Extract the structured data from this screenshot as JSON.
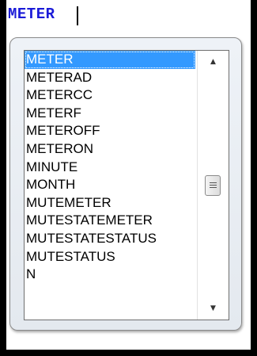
{
  "editor": {
    "text": "METER"
  },
  "autocomplete": {
    "items": [
      "METER",
      "METERAD",
      "METERCC",
      "METERF",
      "METEROFF",
      "METERON",
      "MINUTE",
      "MONTH",
      "MUTEMETER",
      "MUTESTATEMETER",
      "MUTESTATESTATUS",
      "MUTESTATUS",
      "N"
    ],
    "selected_index": 0,
    "scroll_position": 0.5
  },
  "icons": {
    "scroll_up": "scroll-up-arrow-icon",
    "scroll_down": "scroll-down-arrow-icon",
    "thumb_grip": "grip-icon"
  },
  "colors": {
    "editor_text": "#1b1bd8",
    "selection": "#3399ff",
    "frame": "#000000"
  }
}
